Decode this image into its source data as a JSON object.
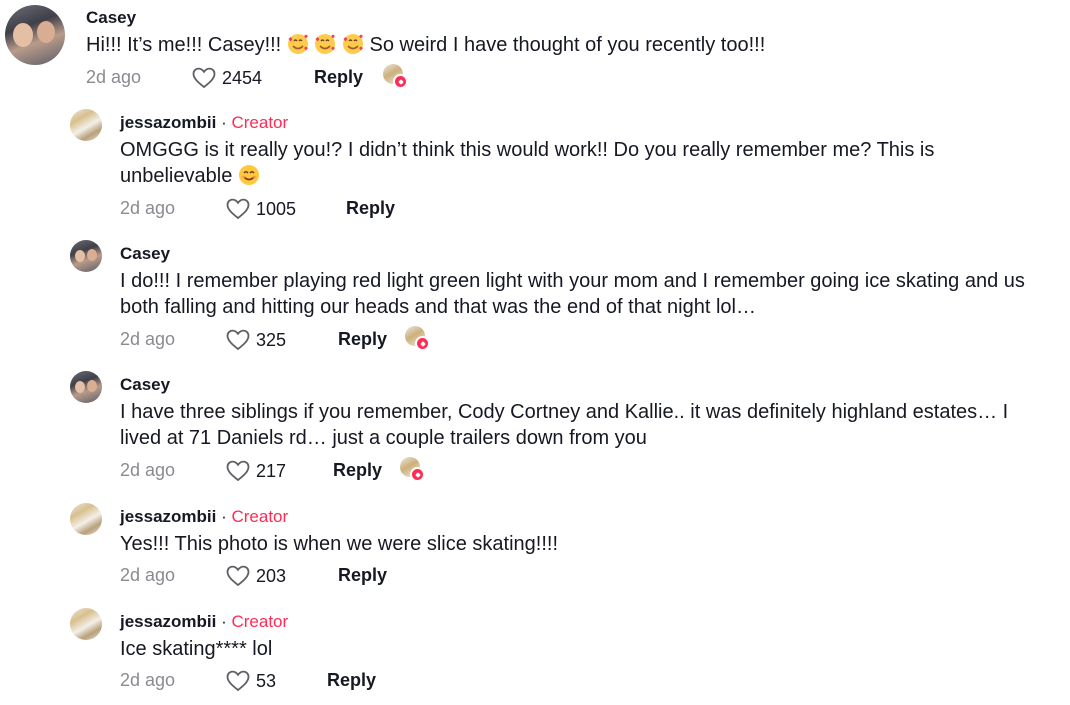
{
  "thread": {
    "comments": [
      {
        "author": "Casey",
        "text_parts": [
          "Hi!!! It’s me!!! Casey!!! ",
          " So weird I have thought of you recently too!!!"
        ],
        "emojis": [
          "smiling-face-with-hearts",
          "smiling-face-with-hearts",
          "smiling-face-with-hearts"
        ],
        "date": "2d ago",
        "likes": "2454",
        "reply": "Reply",
        "liked_by_creator": true
      },
      {
        "author": "jessazombii",
        "separator": " · ",
        "badge": "Creator",
        "text_line1": "OMGGG is it really you!? I didn’t think this would work!! Do you really remember me? This is",
        "text_line2": "unbelievable ",
        "emoji": "smiling-face-with-smiling-eyes",
        "date": "2d ago",
        "likes": "1005",
        "reply": "Reply",
        "liked_by_creator": false
      },
      {
        "author": "Casey",
        "text_line1": "I do!!! I remember playing red light green light with your mom and I remember going ice skating and us",
        "text_line2": "both falling and hitting our heads and that was the end of that night lol…",
        "date": "2d ago",
        "likes": "325",
        "reply": "Reply",
        "liked_by_creator": true
      },
      {
        "author": "Casey",
        "text_line1": "I have three siblings if you remember, Cody Cortney and Kallie.. it was definitely highland estates… I",
        "text_line2": "lived at 71 Daniels rd… just a couple trailers down from you",
        "date": "2d ago",
        "likes": "217",
        "reply": "Reply",
        "liked_by_creator": true
      },
      {
        "author": "jessazombii",
        "separator": " · ",
        "badge": "Creator",
        "text": "Yes!!! This photo is when we were slice skating!!!!",
        "date": "2d ago",
        "likes": "203",
        "reply": "Reply",
        "liked_by_creator": false
      },
      {
        "author": "jessazombii",
        "separator": " · ",
        "badge": "Creator",
        "text": "Ice skating**** lol",
        "date": "2d ago",
        "likes": "53",
        "reply": "Reply",
        "liked_by_creator": false
      }
    ]
  },
  "icons": {
    "like": "heart-outline-icon",
    "creator_liked": "creator-liked-icon"
  },
  "colors": {
    "text": "#161823",
    "muted": "#8a8b91",
    "creator_badge": "#fe2c55"
  }
}
